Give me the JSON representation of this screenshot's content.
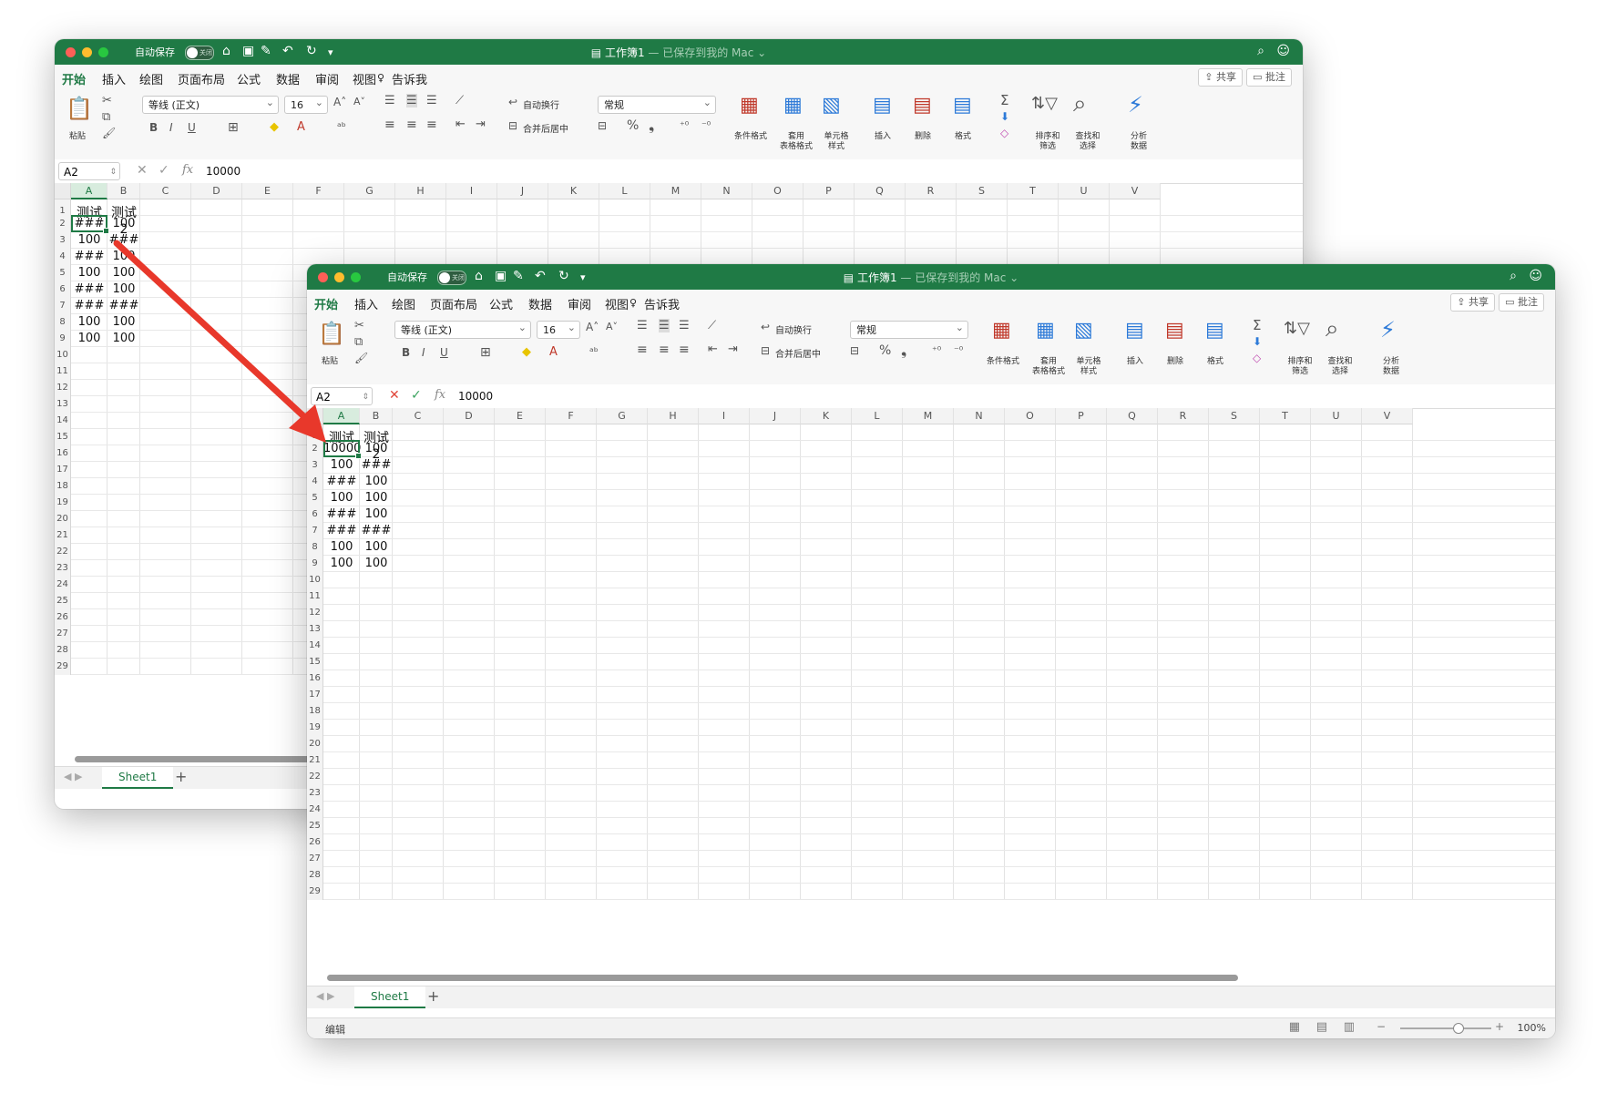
{
  "window": {
    "autosave_label": "自动保存",
    "autosave_state": "关闭",
    "title": "工作簿1",
    "title_suffix": "— 已保存到我的 Mac ⌄"
  },
  "menu": {
    "tabs": [
      "开始",
      "插入",
      "绘图",
      "页面布局",
      "公式",
      "数据",
      "审阅",
      "视图",
      "告诉我"
    ],
    "active_tab": "开始",
    "share": "共享",
    "comments": "批注"
  },
  "ribbon": {
    "paste": "粘贴",
    "font_name": "等线 (正文)",
    "font_size": "16",
    "wrap_text": "自动换行",
    "merge_center": "合并后居中",
    "number_format": "常规",
    "conditional_format": "条件格式",
    "table_format_1": "套用",
    "table_format_2": "表格格式",
    "cell_style_1": "单元格",
    "cell_style_2": "样式",
    "insert": "插入",
    "delete": "删除",
    "format": "格式",
    "sort_filter_1": "排序和",
    "sort_filter_2": "筛选",
    "find_select_1": "查找和",
    "find_select_2": "选择",
    "analyze_1": "分析",
    "analyze_2": "数据",
    "accent_color": "#1f7a45"
  },
  "formula_bar": {
    "name_box": "A2",
    "value": "10000"
  },
  "columns": [
    "A",
    "B",
    "C",
    "D",
    "E",
    "F",
    "G",
    "H",
    "I",
    "J",
    "K",
    "L",
    "M",
    "N",
    "O",
    "P",
    "Q",
    "R",
    "S",
    "T",
    "U",
    "V"
  ],
  "back_sheet": {
    "cells": [
      [
        "测试",
        "测试2"
      ],
      [
        "###",
        "100"
      ],
      [
        "100",
        "###"
      ],
      [
        "###",
        "100"
      ],
      [
        "100",
        "100"
      ],
      [
        "###",
        "100"
      ],
      [
        "###",
        "###"
      ],
      [
        "100",
        "100"
      ],
      [
        "100",
        "100"
      ]
    ]
  },
  "front_sheet": {
    "cells": [
      [
        "测试",
        "测试2"
      ],
      [
        "10000",
        "100"
      ],
      [
        "100",
        "###"
      ],
      [
        "###",
        "100"
      ],
      [
        "100",
        "100"
      ],
      [
        "###",
        "100"
      ],
      [
        "###",
        "###"
      ],
      [
        "100",
        "100"
      ],
      [
        "100",
        "100"
      ]
    ]
  },
  "sheet_tab": "Sheet1",
  "status": {
    "mode": "编辑",
    "zoom": "100%"
  },
  "arrow_color": "#e8382b"
}
